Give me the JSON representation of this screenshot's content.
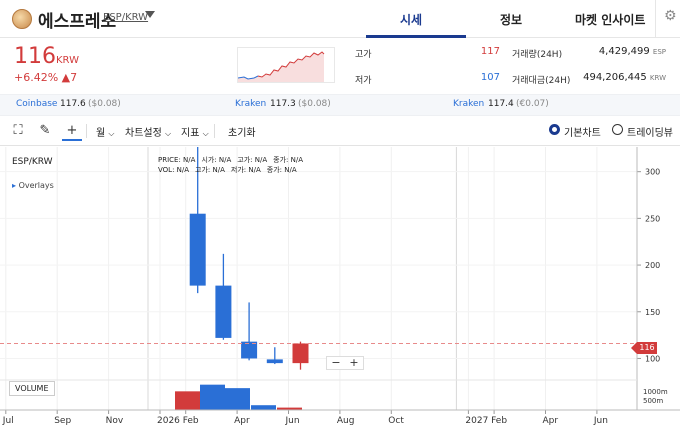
{
  "header": {
    "coin_name": "에스프레소",
    "pair": "ESP/KRW",
    "tabs": [
      "시세",
      "정보",
      "마켓 인사이트"
    ]
  },
  "price": {
    "value": "116",
    "unit": "KRW",
    "change_pct": "+6.42%",
    "change_abs": "▲7"
  },
  "stats": {
    "high_label": "고가",
    "high_value": "117",
    "low_label": "저가",
    "low_value": "107",
    "volume_label": "거래량(24H)",
    "volume_value": "4,429,499",
    "volume_unit": "ESP",
    "amount_label": "거래대금(24H)",
    "amount_value": "494,206,445",
    "amount_unit": "KRW"
  },
  "exchanges": [
    {
      "name": "Coinbase",
      "price": "117.6",
      "diff": "($0.08)"
    },
    {
      "name": "Kraken",
      "price": "117.3",
      "diff": "($0.08)"
    },
    {
      "name": "Kraken",
      "price": "117.4",
      "diff": "(€0.07)"
    }
  ],
  "toolbar": {
    "interval": "월",
    "chart_settings": "차트설정",
    "indicators": "지표",
    "reset": "초기화",
    "basic_chart": "기본차트",
    "tradingview": "트레이딩뷰"
  },
  "chart_labels": {
    "ticker": "ESP/KRW",
    "overlays": "Overlays",
    "volume": "VOLUME",
    "legend_price": "PRICE: N/A",
    "legend_open": "시가: N/A",
    "legend_high": "고가: N/A",
    "legend_close": "종가: N/A",
    "legend_vol": "VOL: N/A",
    "legend_high2": "고가: N/A",
    "legend_low": "저가: N/A",
    "legend_close2": "종가: N/A",
    "current_price_tag": "116",
    "zoom_out": "−",
    "zoom_in": "+"
  },
  "colors": {
    "up": "#d23b3b",
    "down": "#2a6fd6",
    "accent": "#1a3a8f"
  },
  "chart_data": {
    "type": "candlestick",
    "interval": "monthly",
    "x_tick_labels": [
      "Jul",
      "Sep",
      "Nov",
      "2026",
      "Feb",
      "Apr",
      "Jun",
      "Aug",
      "Oct",
      "2027",
      "Feb",
      "Apr",
      "Jun"
    ],
    "y_ticks": [
      100,
      150,
      200,
      250,
      300
    ],
    "volume_ticks": [
      "1000m",
      "500m"
    ],
    "ylim": [
      78,
      320
    ],
    "current_price": 116,
    "candles": [
      {
        "x": "2026-02",
        "open": 255,
        "high": 340,
        "low": 170,
        "close": 178
      },
      {
        "x": "2026-03",
        "open": 178,
        "high": 212,
        "low": 120,
        "close": 122
      },
      {
        "x": "2026-04",
        "open": 118,
        "high": 160,
        "low": 98,
        "close": 100
      },
      {
        "x": "2026-05",
        "open": 99,
        "high": 112,
        "low": 94,
        "close": 95
      },
      {
        "x": "2026-06",
        "open": 95,
        "high": 118,
        "low": 88,
        "close": 116
      }
    ],
    "volume": [
      {
        "x": "2026-02",
        "value": 700,
        "direction": "up"
      },
      {
        "x": "2026-02b",
        "value": 950,
        "direction": "down"
      },
      {
        "x": "2026-04",
        "value": 820,
        "direction": "down"
      },
      {
        "x": "2026-05",
        "value": 180,
        "direction": "down"
      },
      {
        "x": "2026-06",
        "value": 90,
        "direction": "up"
      }
    ]
  }
}
